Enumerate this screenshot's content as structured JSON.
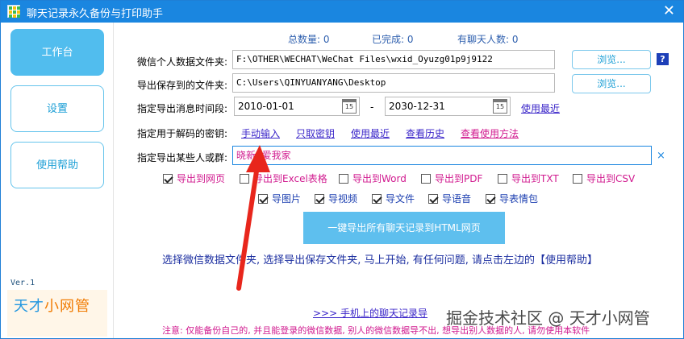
{
  "window": {
    "title": "聊天记录永久备份与打印助手"
  },
  "sidebar": {
    "items": [
      {
        "label": "工作台",
        "active": true
      },
      {
        "label": "设置",
        "active": false
      },
      {
        "label": "使用帮助",
        "active": false
      }
    ],
    "version": "Ver.1",
    "brand_part1": "天才",
    "brand_part2": "小网管"
  },
  "stats": {
    "total": "总数量: 0",
    "done": "已完成: 0",
    "people": "有聊天人数: 0"
  },
  "form": {
    "wechat_folder_label": "微信个人数据文件夹:",
    "wechat_folder_value": "F:\\OTHER\\WECHAT\\WeChat Files\\wxid_Oyuzg01p9j9122",
    "save_folder_label": "导出保存到的文件夹:",
    "save_folder_value": "C:\\Users\\QINYUANYANG\\Desktop",
    "browse_label": "浏览...",
    "help_q": "?",
    "time_label": "指定导出消息时间段:",
    "date_start": "2010-01-01",
    "date_dash": "-",
    "date_end": "2030-12-31",
    "calendar_day": "15",
    "use_recent_label": "使用最近",
    "key_label": "指定用于解码的密钥:",
    "key_links": [
      "手动输入",
      "只取密钥",
      "使用最近",
      "查看历史",
      "查看使用方法"
    ],
    "target_label": "指定导出某些人或群:",
    "target_value": "晓新, 爱我家",
    "clear_x": "×"
  },
  "export_formats": [
    {
      "label": "导出到网页",
      "checked": true
    },
    {
      "label": "导出到Excel表格",
      "checked": false
    },
    {
      "label": "导出到Word",
      "checked": false
    },
    {
      "label": "导出到PDF",
      "checked": false
    },
    {
      "label": "导出到TXT",
      "checked": false
    },
    {
      "label": "导出到CSV",
      "checked": false
    }
  ],
  "export_content": [
    {
      "label": "导图片",
      "checked": true
    },
    {
      "label": "导视频",
      "checked": true
    },
    {
      "label": "导文件",
      "checked": true
    },
    {
      "label": "导语音",
      "checked": true
    },
    {
      "label": "导表情包",
      "checked": true
    }
  ],
  "main_button": "一键导出所有聊天记录到HTML网页",
  "tip": "选择微信数据文件夹, 选择导出保存文件夹, 马上开始, 有任何问题, 请点击左边的【使用帮助】",
  "phone_link": ">>>   手机上的聊天记录导",
  "note": "注意: 仅能备份自己的, 并且能登录的微信数据, 别人的微信数据导不出, 想导出别人数据的人, 请勿使用本软件",
  "watermark": "掘金技术社区 @ 天才小网管",
  "colors": {
    "titlebar": "#1a86e0",
    "accent": "#51bdee",
    "pink": "#d11a8f",
    "link": "#3b26c9",
    "arrow": "#e8261c"
  }
}
